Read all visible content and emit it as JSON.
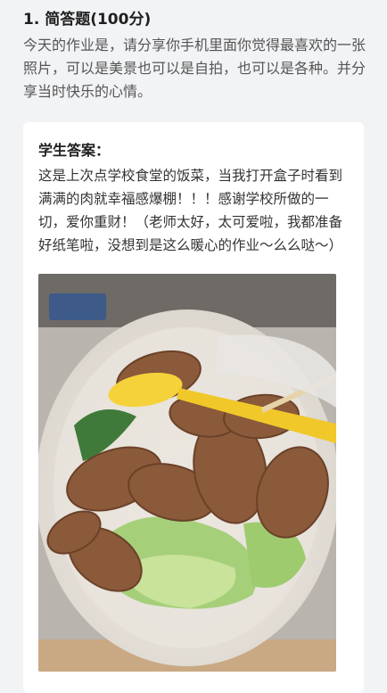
{
  "question": {
    "title": "1. 简答题(100分)",
    "text": "今天的作业是，请分享你手机里面你觉得最喜欢的一张照片，可以是美景也可以是自拍，也可以是各种。并分享当时快乐的心情。"
  },
  "answer": {
    "label": "学生答案：",
    "text": "这是上次点学校食堂的饭菜，当我打开盒子时看到满满的肉就幸福感爆棚！！！感谢学校所做的一切，爱你重财！（老师太好，太可爱啦，我都准备好纸笔啦，没想到是这么暖心的作业～么么哒～）",
    "photo_description_icon": "food-photo"
  }
}
